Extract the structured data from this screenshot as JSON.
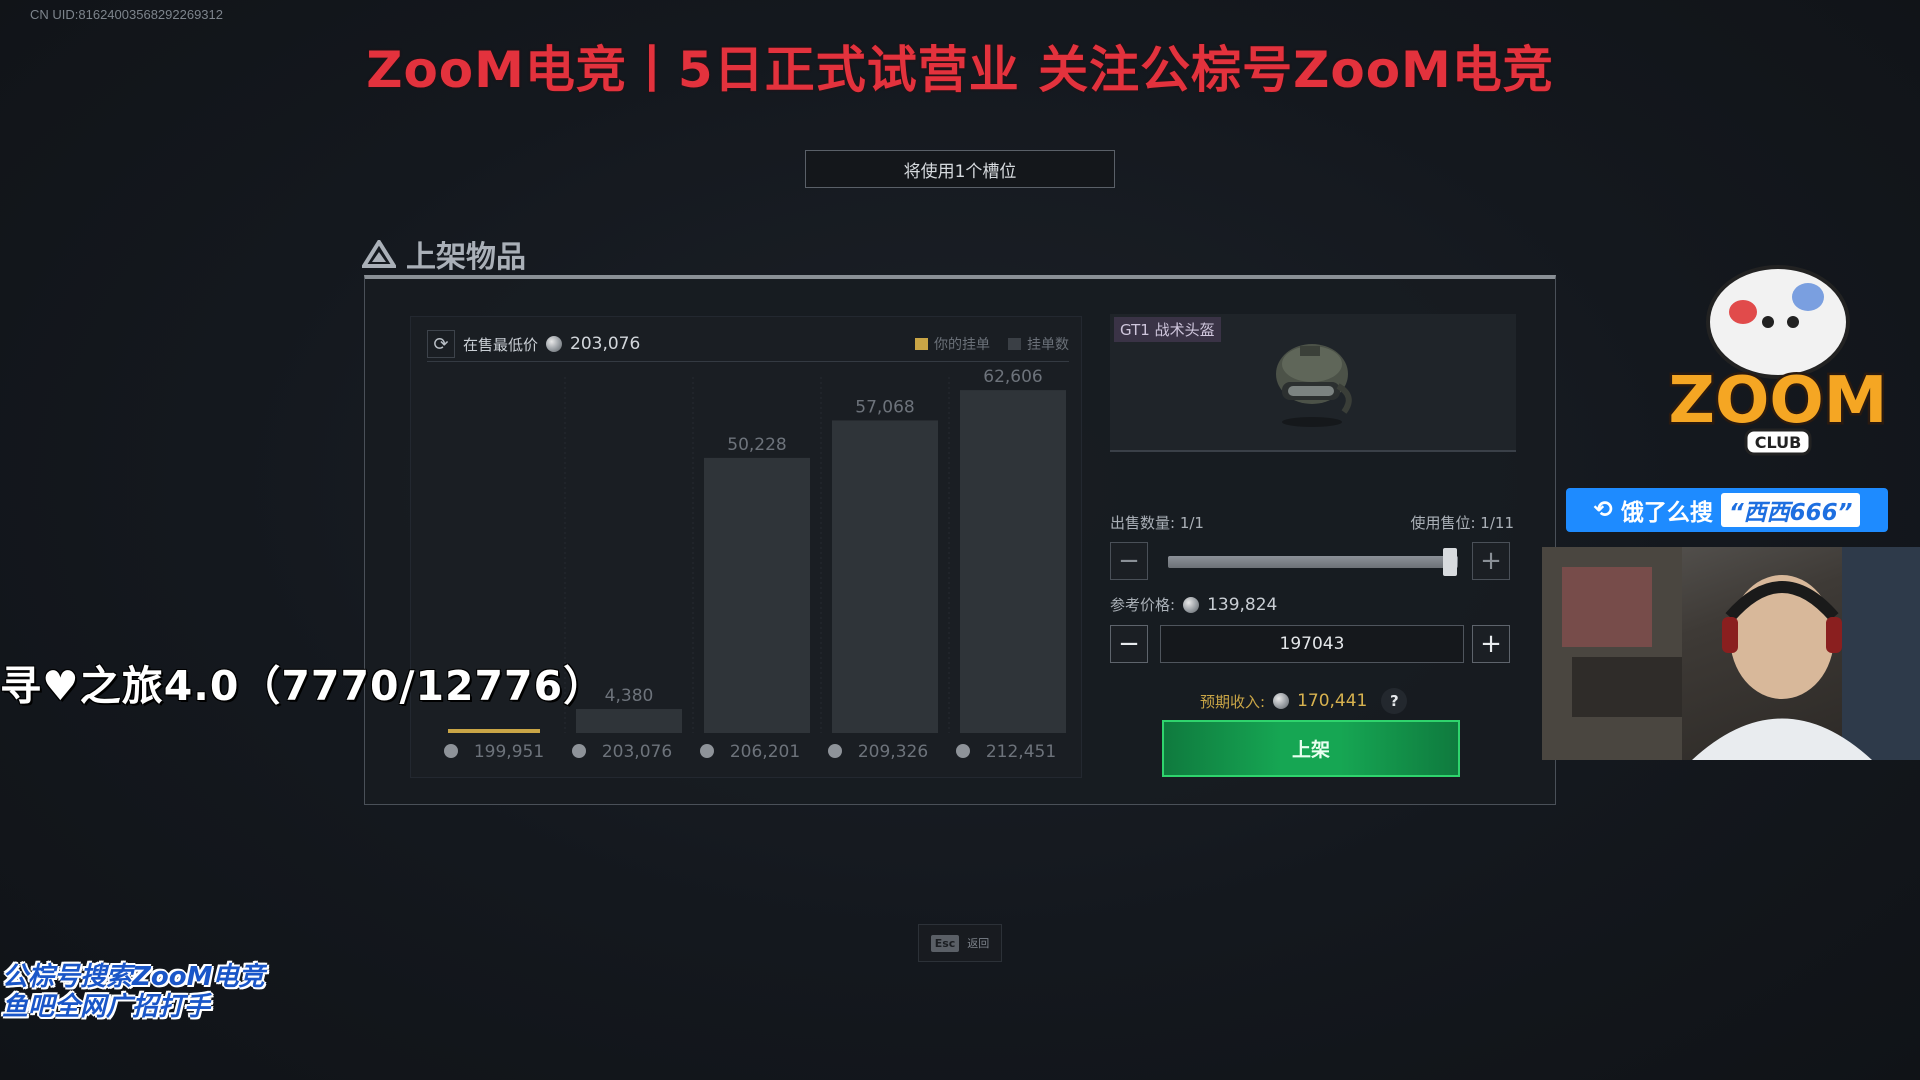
{
  "overlay": {
    "uid": "CN UID:81624003568292269312",
    "banner": "ZooM电竞丨5日正式试营业 关注公棕号ZooM电竞",
    "quest": "寻♥之旅4.0（7770/12776）",
    "promo_line1": "公棕号搜索ZooM电竞",
    "promo_line2": "鱼吧全网广招打手",
    "search_prefix": "饿了么搜",
    "search_term": "“西西666”",
    "logo_word": "ZOOM",
    "logo_sub": "CLUB"
  },
  "notice": {
    "slot_usage": "将使用1个槽位"
  },
  "section": {
    "title": "上架物品"
  },
  "market": {
    "lowest_label": "在售最低价",
    "lowest_price": "203,076",
    "legend_mine": "你的挂单",
    "legend_count": "挂单数"
  },
  "chart_data": {
    "type": "bar",
    "categories": [
      "199,951",
      "203,076",
      "206,201",
      "209,326",
      "212,451"
    ],
    "series": [
      {
        "name": "挂单数",
        "values": [
          0,
          4380,
          50228,
          57068,
          62606
        ]
      }
    ],
    "value_labels": [
      "",
      "4,380",
      "50,228",
      "57,068",
      "62,606"
    ],
    "highlight_index": 0,
    "ylim": [
      0,
      65000
    ],
    "colors": {
      "bar": "#2f3439",
      "highlight": "#c9a546",
      "label": "#6d737b",
      "xlabel": "#6d737b"
    }
  },
  "item": {
    "name": "GT1 战术头盔"
  },
  "sale": {
    "qty_label": "出售数量: 1/1",
    "slots_label": "使用售位: 1/11",
    "qty_fraction": 1.0,
    "ref_label": "参考价格:",
    "ref_price": "139,824",
    "price_input": "197043",
    "income_label": "预期收入:",
    "income_value": "170,441",
    "help": "?",
    "list_button": "上架",
    "minus": "−",
    "plus": "+"
  },
  "footer": {
    "esc_key": "Esc",
    "esc_label": "返回"
  }
}
